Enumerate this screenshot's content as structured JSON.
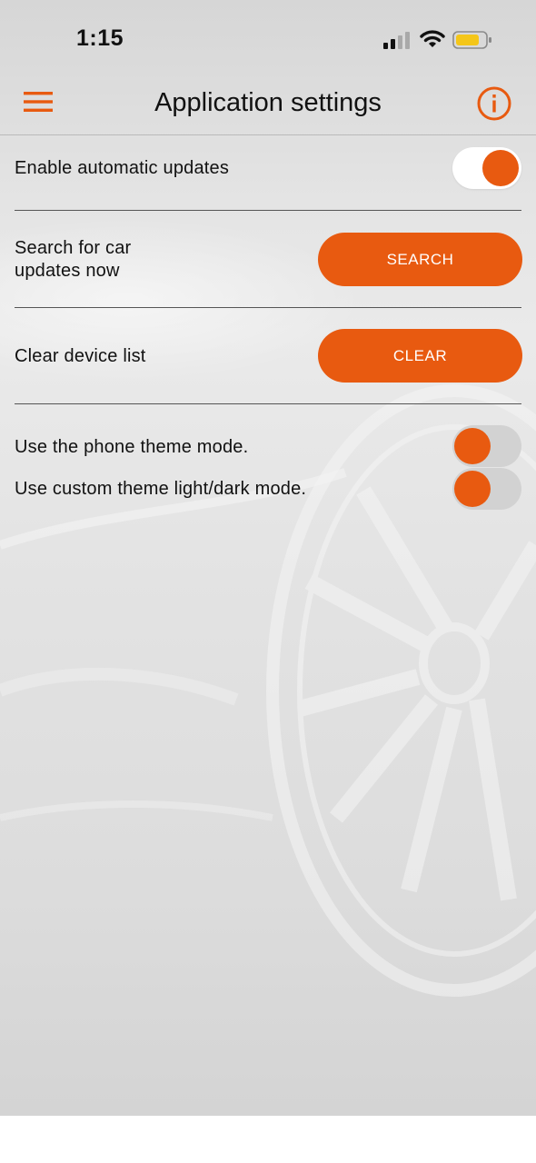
{
  "status_bar": {
    "time": "1:15"
  },
  "nav": {
    "title": "Application settings",
    "menu_icon": "hamburger-menu-icon",
    "info_icon": "info-circle-icon"
  },
  "settings": {
    "auto_updates": {
      "label": "Enable automatic updates",
      "enabled": true
    },
    "search_updates": {
      "label_line1": "Search for car",
      "label_line2": "updates now",
      "button_label": "SEARCH"
    },
    "clear_devices": {
      "label": "Clear device list",
      "button_label": "CLEAR"
    },
    "phone_theme": {
      "label": "Use the phone theme mode.",
      "enabled": false
    },
    "custom_theme": {
      "label": "Use custom theme light/dark mode.",
      "enabled": false
    }
  },
  "colors": {
    "accent": "#e85a10",
    "background": "#e4e4e4",
    "text": "#111111"
  }
}
